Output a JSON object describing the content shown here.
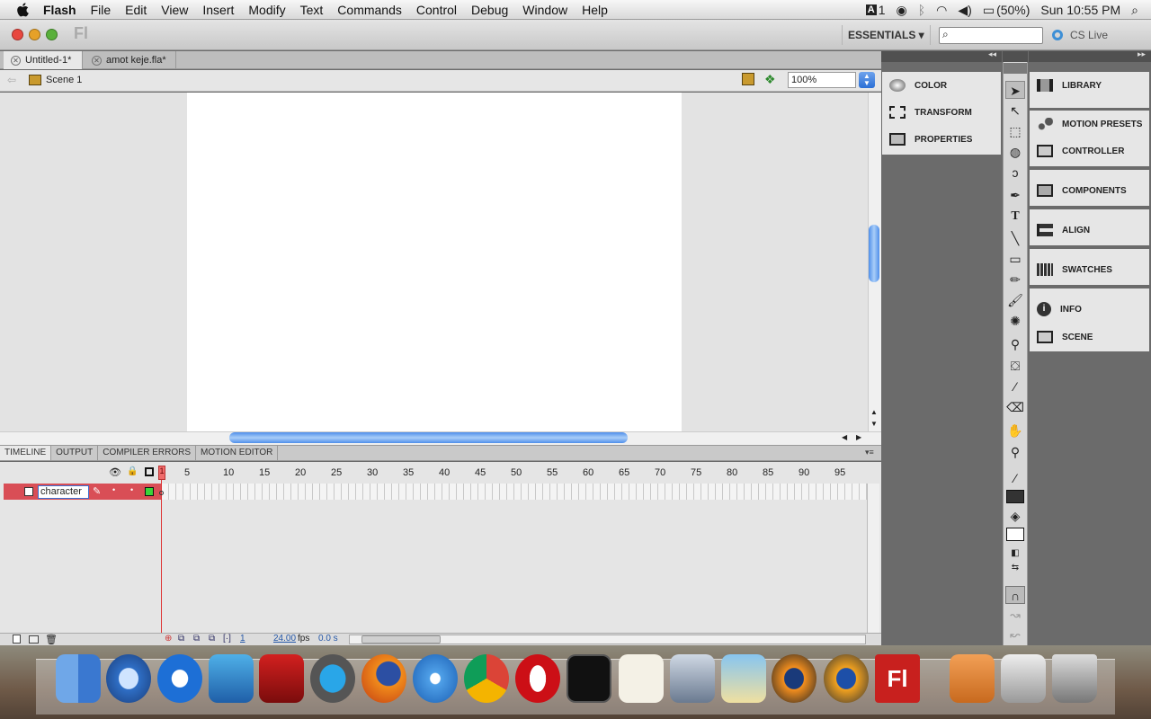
{
  "menubar": {
    "app": "Flash",
    "items": [
      "File",
      "Edit",
      "View",
      "Insert",
      "Modify",
      "Text",
      "Commands",
      "Control",
      "Debug",
      "Window",
      "Help"
    ],
    "status": {
      "adobe_count": "1",
      "battery": "(50%)",
      "clock": "Sun 10:55 PM"
    }
  },
  "titlebar": {
    "logo": "Fl",
    "workspace": "ESSENTIALS ▾",
    "cs_live": "CS Live"
  },
  "tabs": [
    {
      "label": "Untitled-1*"
    },
    {
      "label": "amot keje.fla*"
    }
  ],
  "editbar": {
    "scene": "Scene 1",
    "zoom": "100%"
  },
  "timeline": {
    "tabs": [
      "TIMELINE",
      "OUTPUT",
      "COMPILER ERRORS",
      "MOTION EDITOR"
    ],
    "frame_numbers": [
      "1",
      "5",
      "10",
      "15",
      "20",
      "25",
      "30",
      "35",
      "40",
      "45",
      "50",
      "55",
      "60",
      "65",
      "70",
      "75",
      "80",
      "85",
      "90",
      "95"
    ],
    "layer_name": "character",
    "current_frame": "1",
    "fps": "24.00",
    "fps_unit": "fps",
    "time": "0.0 s"
  },
  "panels_left": [
    {
      "label": "COLOR",
      "icon": "color-icon"
    },
    {
      "label": "TRANSFORM",
      "icon": "transform-icon"
    },
    {
      "label": "PROPERTIES",
      "icon": "properties-icon"
    }
  ],
  "panels_right": [
    {
      "label": "LIBRARY",
      "icon": "library-icon"
    },
    {
      "label": "MOTION PRESETS",
      "icon": "motion-presets-icon"
    },
    {
      "label": "CONTROLLER",
      "icon": "controller-icon"
    },
    {
      "label": "COMPONENTS",
      "icon": "components-icon"
    },
    {
      "label": "ALIGN",
      "icon": "align-icon"
    },
    {
      "label": "SWATCHES",
      "icon": "swatches-icon"
    },
    {
      "label": "INFO",
      "icon": "info-icon"
    },
    {
      "label": "SCENE",
      "icon": "scene-icon"
    }
  ],
  "colors": {
    "layer_selected": "#d94e56",
    "scroll_accent": "#4f8fea",
    "flash_red": "#c8201e"
  },
  "dock": [
    "Finder",
    "QuickTime Player",
    "RealPlayer SP",
    "iTunes",
    "Photo Booth",
    "Skype",
    "Firefox",
    "Safari",
    "Chrome",
    "Opera",
    "Activity Monitor",
    "TextEdit",
    "Remote Desktop",
    "iPhoto",
    "Image Capture",
    "Vuze",
    "Flash",
    "Applications",
    "Printer",
    "Trash"
  ]
}
